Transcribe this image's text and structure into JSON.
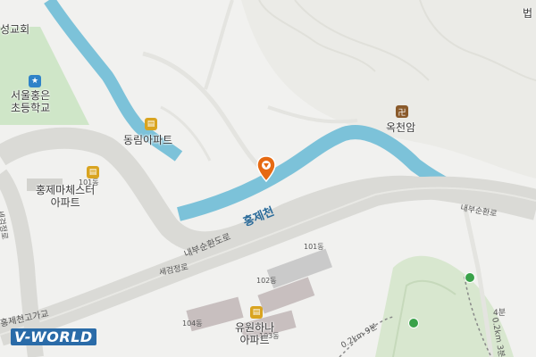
{
  "map": {
    "labels": {
      "church_partial": "성교회",
      "law_partial": "법",
      "school": "서울홍은\n초등학교",
      "dongrim": "동림아파트",
      "okcheonam": "옥천암",
      "hongje_master": "홍제마체스터\n아파트",
      "bldg_101_left": "101동",
      "road_sejong_left": "세검정로",
      "road_naebu_mid": "내부순환도로",
      "stream_hongjecheon": "홍제천",
      "road_naebu_right": "내부순환로",
      "road_segeom_mid": "세검정로",
      "bldg_101": "101동",
      "bldg_102": "102동",
      "bldg_104": "104동",
      "bldg_103": "103동",
      "yuwon": "유원하나\n아파트",
      "trail_02km": "0.2km 9분",
      "trail_right": "0.2km 3분",
      "trail_4": "4분",
      "hongjecheon_ga": "홍제천고가교"
    },
    "logo": "V-WORLD",
    "colors": {
      "background": "#f1f1ef",
      "water": "#7cc2d9",
      "green": "#cfe6c8",
      "road": "#dadad6",
      "marker": "#e66a12"
    },
    "icons": {
      "school_icon": "school",
      "apartment_icon": "building",
      "temple_icon": "manji",
      "location_marker": "pin"
    }
  }
}
